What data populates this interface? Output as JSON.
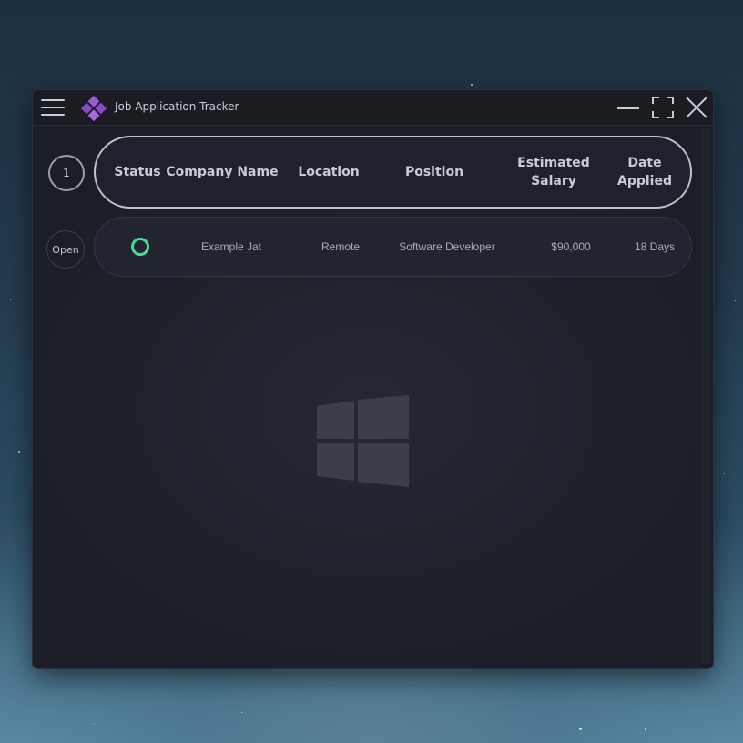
{
  "window": {
    "title": "Job Application Tracker"
  },
  "pagination": {
    "current_page": "1"
  },
  "table": {
    "headers": {
      "status": "Status",
      "company": "Company Name",
      "location": "Location",
      "position": "Position",
      "salary_line1": "Estimated",
      "salary_line2": "Salary",
      "date_line1": "Date",
      "date_line2": "Applied"
    },
    "rows": [
      {
        "action_label": "Open",
        "status": "active",
        "status_color": "#3ee092",
        "company": "Example Jat",
        "location": "Remote",
        "position": "Software Developer",
        "salary": "$90,000",
        "date_applied": "18 Days"
      }
    ]
  },
  "colors": {
    "accent": "#8e4fc9",
    "status_open": "#3ee092",
    "window_bg": "#1b1e26"
  },
  "icons": [
    "hamburger-menu-icon",
    "app-logo-icon",
    "minimize-icon",
    "maximize-icon",
    "close-icon",
    "windows-logo"
  ]
}
